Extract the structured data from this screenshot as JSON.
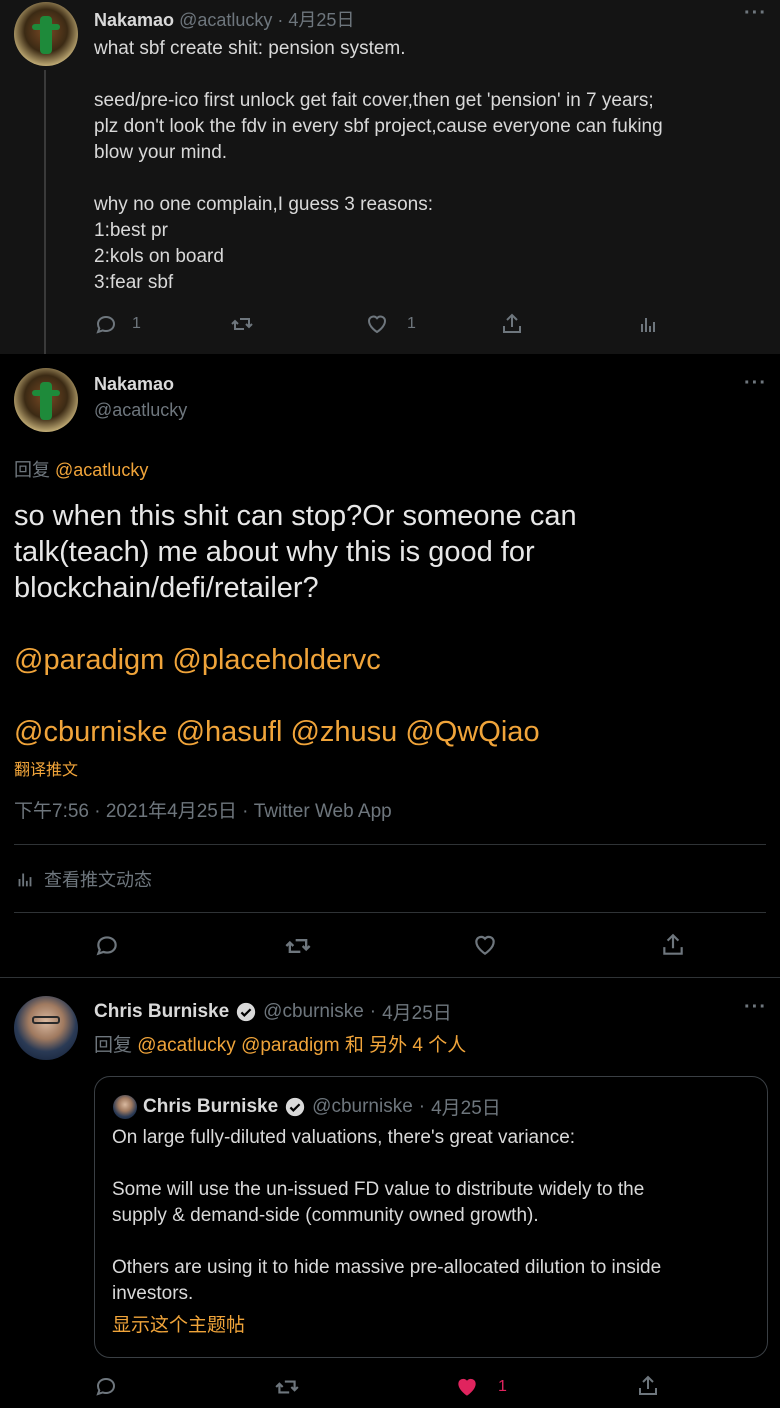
{
  "tweet1": {
    "author_name": "Nakamao",
    "author_handle": "@acatlucky",
    "date": "4月25日",
    "sep": "·",
    "lines": [
      "what sbf create shit: pension system.",
      "seed/pre-ico first unlock get fait cover,then get 'pension' in 7 years;",
      "plz don't look the fdv in every sbf project,cause everyone can fuking",
      "blow your mind.",
      "why no one complain,I guess 3 reasons:",
      "1:best pr",
      "2:kols on board",
      "3:fear sbf"
    ],
    "reply_count": "1",
    "like_count": "1"
  },
  "tweet2": {
    "author_name": "Nakamao",
    "author_handle": "@acatlucky",
    "reply_prefix": "回复",
    "reply_to": "@acatlucky",
    "body_lines": [
      "so when this shit can stop?Or someone can",
      "talk(teach) me about why this is good for",
      "blockchain/defi/retailer?"
    ],
    "mentions_line1": "@paradigm @placeholdervc",
    "mentions_line2": "@cburniske @hasufl @zhusu @QwQiao",
    "translate": "翻译推文",
    "meta": "下午7:56 · 2021年4月25日 · Twitter Web App",
    "activity": "查看推文动态"
  },
  "tweet3": {
    "author_name": "Chris Burniske",
    "author_handle": "@cburniske",
    "sep": "·",
    "date": "4月25日",
    "reply_prefix": "回复",
    "reply_mentions": "@acatlucky @paradigm",
    "reply_suffix": "和 另外 4 个人",
    "like_count": "1",
    "quote": {
      "author_name": "Chris Burniske",
      "author_handle": "@cburniske",
      "sep": "·",
      "date": "4月25日",
      "lines": [
        "On large fully-diluted valuations, there's great variance:",
        "Some will use the un-issued FD value to distribute widely to the",
        "supply & demand-side (community owned growth).",
        "Others are using it to hide massive pre-allocated dilution to inside",
        "investors."
      ],
      "show_thread": "显示这个主题帖"
    }
  },
  "colors": {
    "background": "#000000",
    "top_tweet_bg": "#141414",
    "text": "#d9d9d9",
    "muted": "#6e767d",
    "link": "#f0a43a",
    "like": "#e0245e",
    "divider": "#2f3336"
  }
}
